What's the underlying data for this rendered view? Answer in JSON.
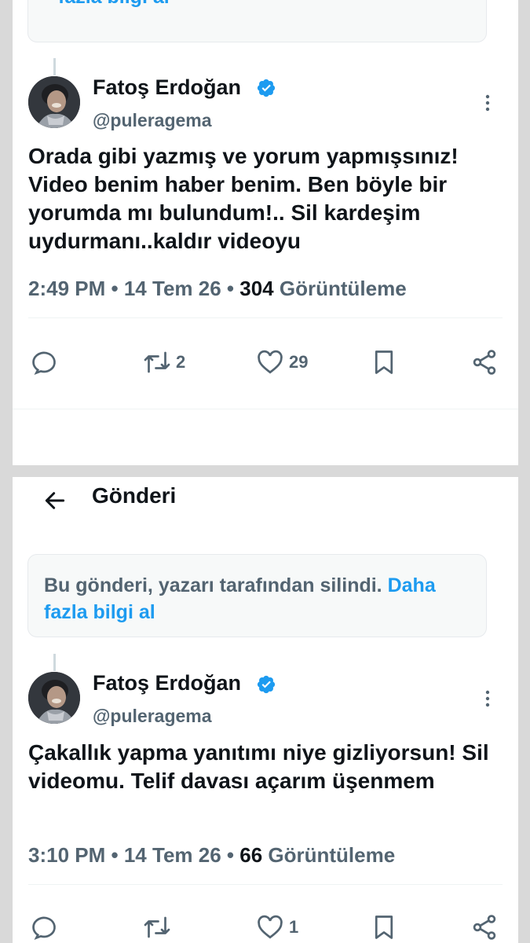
{
  "panel_top": {
    "banner_link_fragment": "fazla bilgi al",
    "tweet": {
      "name": "Fatoş Erdoğan",
      "handle": "@puleragema",
      "text": "Orada gibi yazmış ve yorum yapmışsınız! Video benim haber benim. Ben böyle bir yorumda mı bulundum!.. Sil kardeşim uydurmanı..kaldır videoyu",
      "time": "2:49 PM",
      "date": "14 Tem 26",
      "views_count": "304",
      "views_label": "Görüntüleme",
      "retweets": "2",
      "likes": "29"
    }
  },
  "panel_bottom": {
    "header_title": "Gönderi",
    "banner_text": "Bu gönderi, yazarı tarafından silindi.",
    "banner_link": "Daha fazla bilgi al",
    "tweet": {
      "name": "Fatoş Erdoğan",
      "handle": "@puleragema",
      "text": "Çakallık yapma yanıtımı niye gizliyorsun! Sil videomu. Telif davası açarım üşenmem",
      "time": "3:10 PM",
      "date": "14 Tem 26",
      "views_count": "66",
      "views_label": "Görüntüleme",
      "likes": "1"
    }
  },
  "separator": "•",
  "icons": [
    "back-arrow-icon",
    "verified-badge-icon",
    "more-options-icon",
    "reply-icon",
    "retweet-icon",
    "like-icon",
    "bookmark-icon",
    "share-icon"
  ],
  "colors": {
    "accent": "#1d9bf0",
    "text": "#0f1419",
    "muted": "#536471",
    "banner_bg": "#f7f9f9"
  }
}
